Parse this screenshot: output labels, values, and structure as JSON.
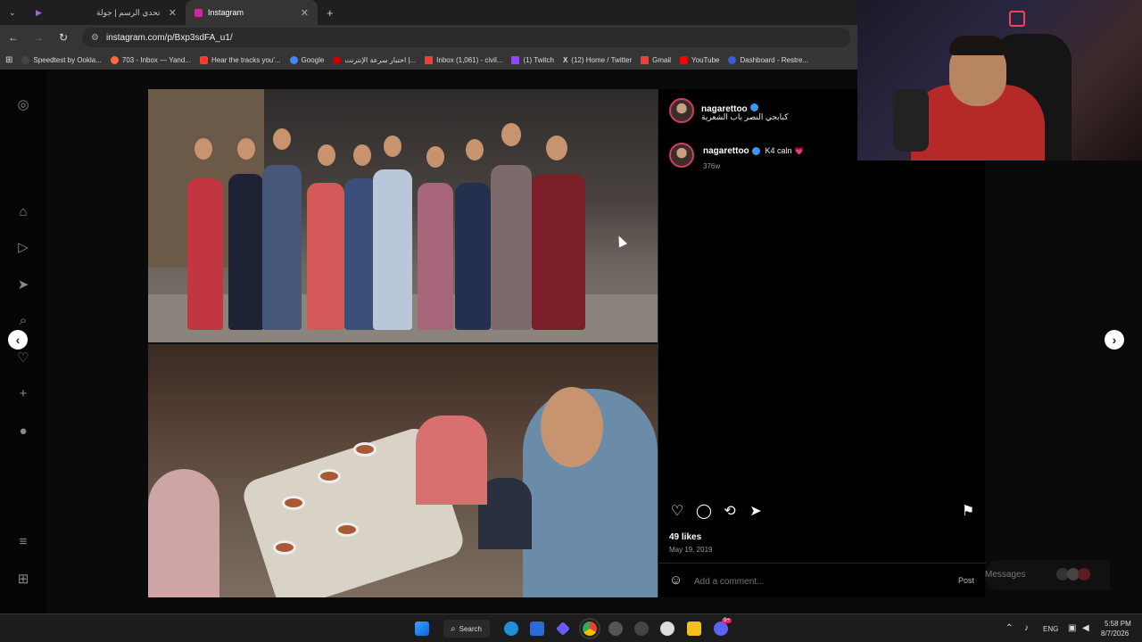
{
  "browser": {
    "tabs": [
      {
        "title": "تحدي الرسم | جولة",
        "active": false
      },
      {
        "title": "Instagram",
        "active": true
      }
    ],
    "new_tab": "+",
    "url": "instagram.com/p/Bxp3sdFA_u1/",
    "bookmarks": [
      "Speedtest by Ookla...",
      "703 - Inbox — Yand...",
      "Hear the tracks you'...",
      "Google",
      "اختبار سرعة الإنترنت |...",
      "Inbox (1,061) - civil...",
      "(1) Twitch",
      "(12) Home / Twitter",
      "Gmail",
      "YouTube",
      "Dashboard - Restre..."
    ]
  },
  "post": {
    "author": "nagarettoo",
    "location_caption": "كبابجي النصر باب الشعرية",
    "comment_author": "nagarettoo",
    "comment_text": "K4 caln 💗",
    "comment_age": "376w",
    "likes": "49 likes",
    "date": "May 19, 2019",
    "add_comment_placeholder": "Add a comment...",
    "post_button": "Post"
  },
  "messages": {
    "label": "Messages"
  },
  "taskbar": {
    "search": "Search",
    "lang": "ENG",
    "time": "5:58 PM",
    "date": "8/7/2026",
    "badge": "9+"
  },
  "colors": {
    "accent_blue": "#3897f0",
    "heart_pink": "#ff4d8a",
    "story_ring": "#d33b6d"
  }
}
